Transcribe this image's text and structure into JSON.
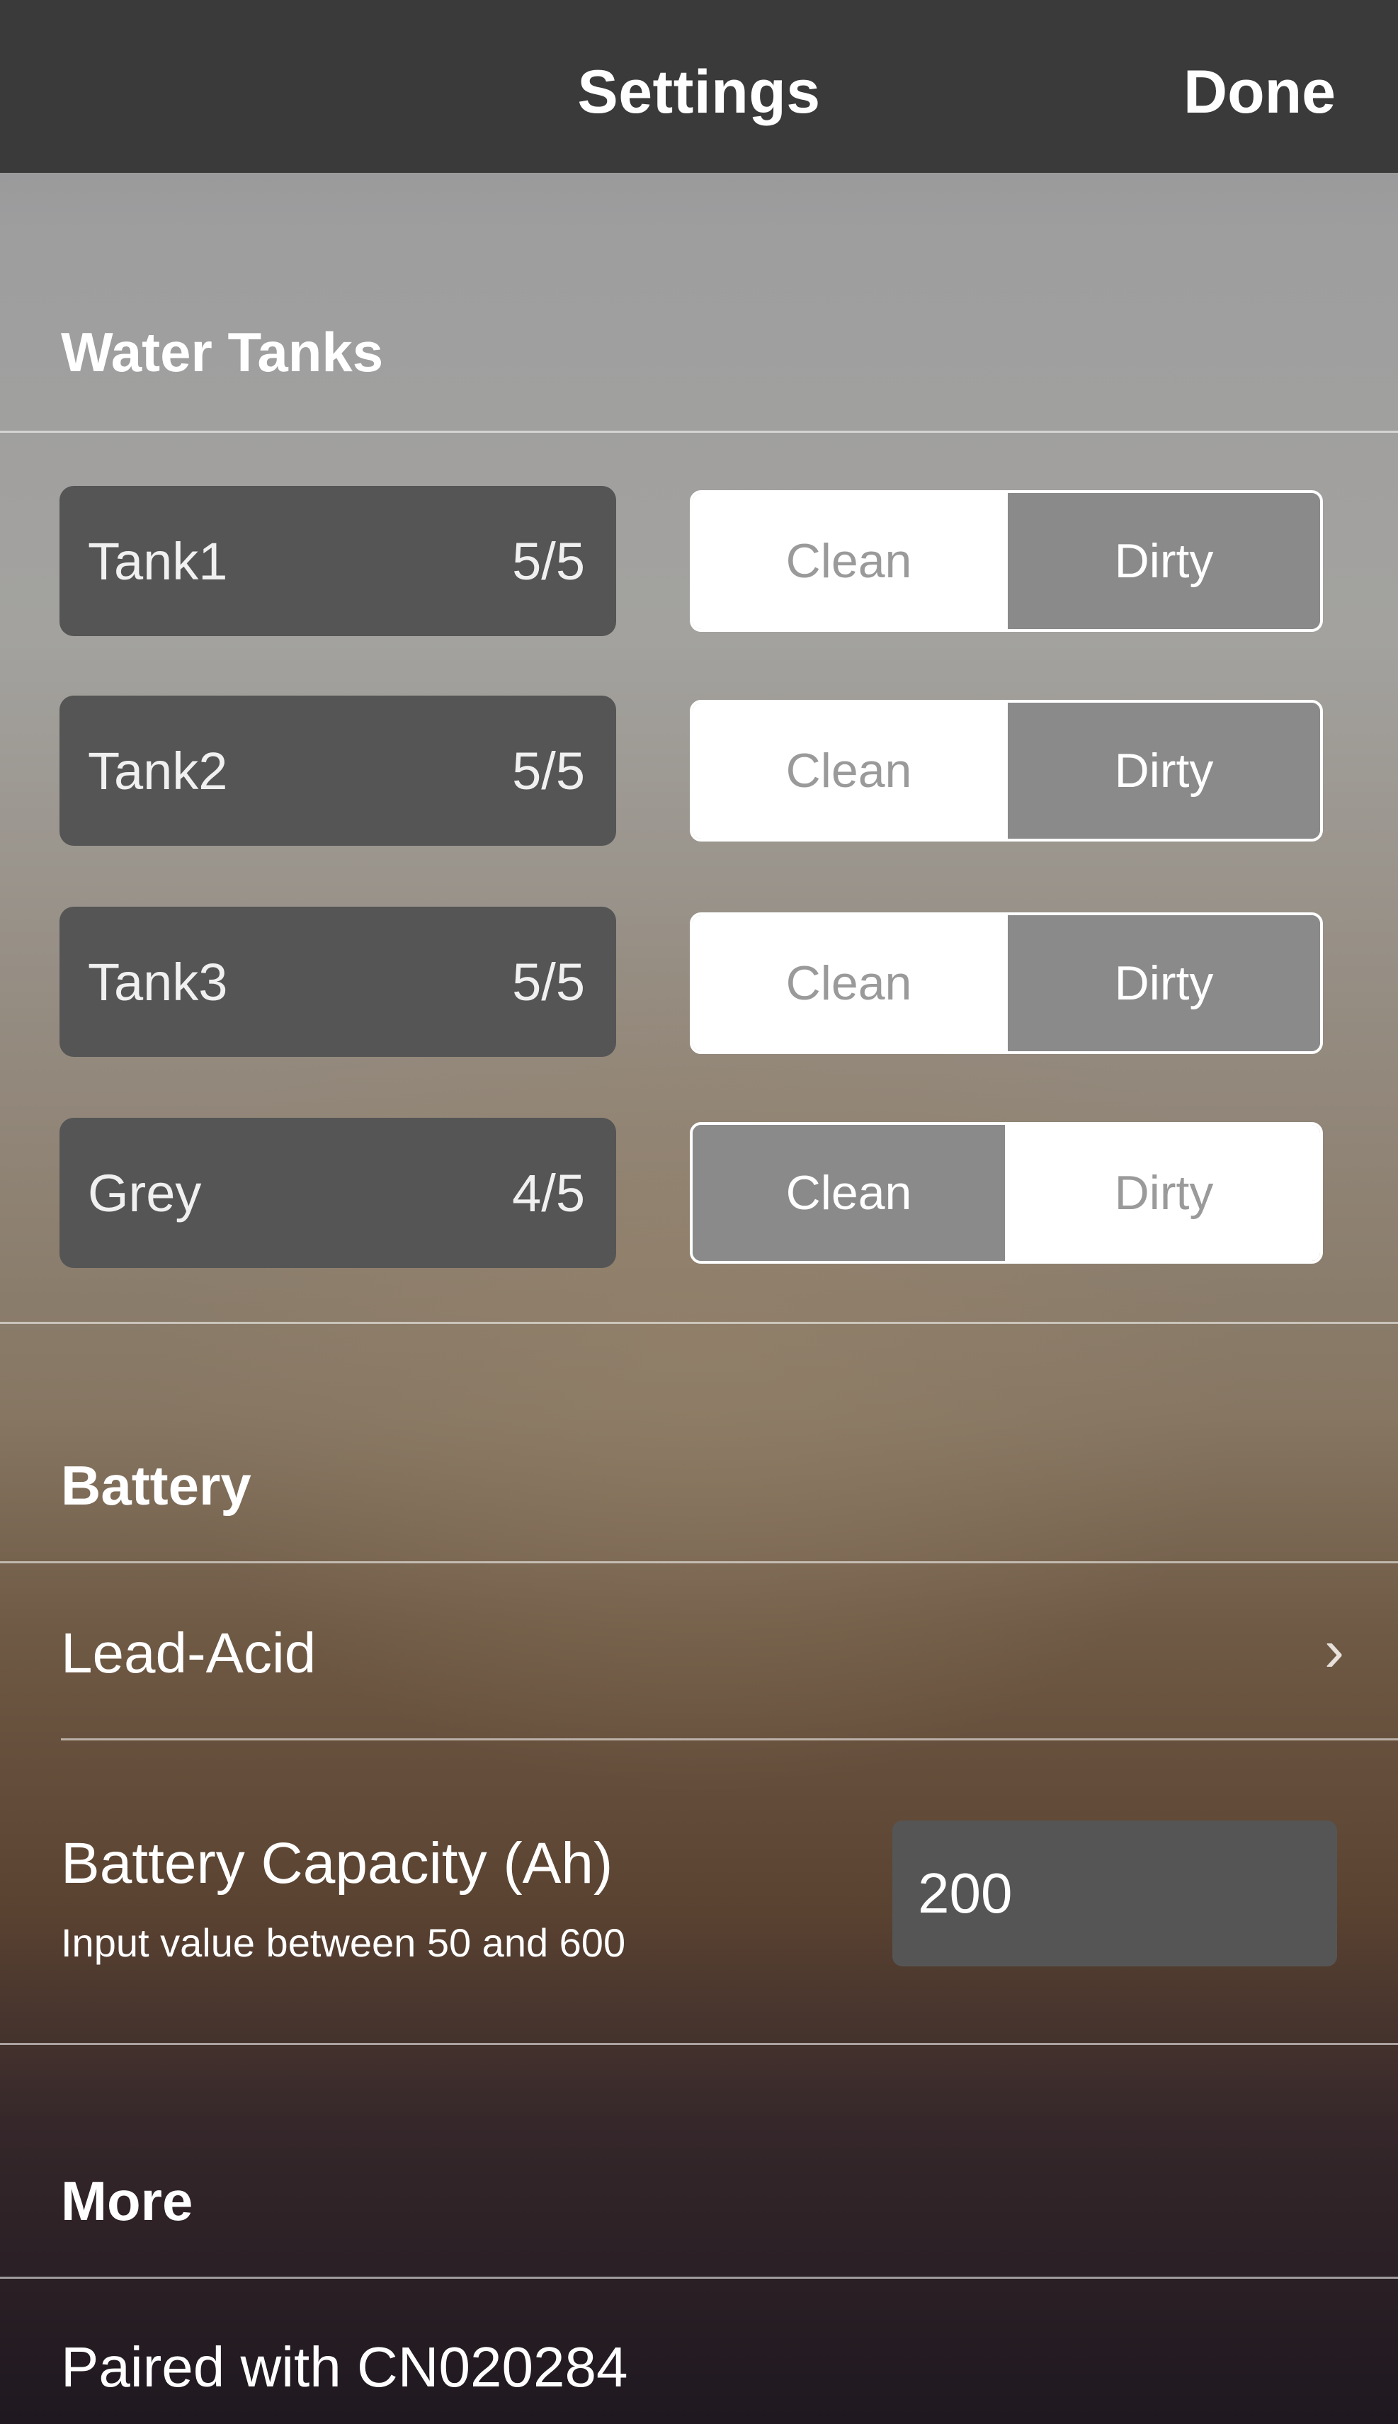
{
  "header": {
    "title": "Settings",
    "done_label": "Done"
  },
  "water_tanks": {
    "section_title": "Water Tanks",
    "tanks": [
      {
        "name": "Tank1",
        "level": "5/5",
        "clean_label": "Clean",
        "dirty_label": "Dirty",
        "selected": "Clean"
      },
      {
        "name": "Tank2",
        "level": "5/5",
        "clean_label": "Clean",
        "dirty_label": "Dirty",
        "selected": "Clean"
      },
      {
        "name": "Tank3",
        "level": "5/5",
        "clean_label": "Clean",
        "dirty_label": "Dirty",
        "selected": "Clean"
      },
      {
        "name": "Grey",
        "level": "4/5",
        "clean_label": "Clean",
        "dirty_label": "Dirty",
        "selected": "Dirty"
      }
    ]
  },
  "battery": {
    "section_title": "Battery",
    "type_label": "Lead-Acid",
    "chevron_icon": "chevron-right-icon",
    "capacity_label": "Battery Capacity (Ah)",
    "capacity_hint": "Input value between 50 and 600",
    "capacity_value": "200"
  },
  "more": {
    "section_title": "More",
    "paired_label": "Paired with CN020284"
  }
}
